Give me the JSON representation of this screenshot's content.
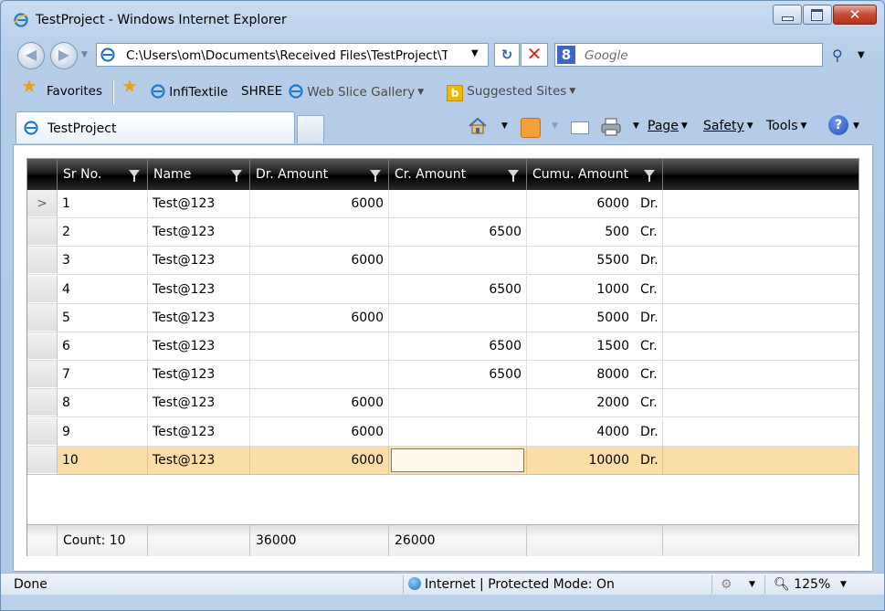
{
  "window": {
    "title": "TestProject - Windows Internet Explorer",
    "close_glyph": "✕"
  },
  "nav": {
    "back_glyph": "◀",
    "forward_glyph": "▶",
    "address": "C:\\Users\\om\\Documents\\Received Files\\TestProject\\Test",
    "search_placeholder": "Google",
    "search_logo": "8",
    "refresh_glyph": "↻",
    "stop_glyph": "✕",
    "search_go_glyph": "⚲"
  },
  "favorites": {
    "favorites_label": "Favorites",
    "links": [
      "InfiTextile",
      "SHREE",
      "Web Slice Gallery",
      "Suggested Sites"
    ]
  },
  "tab": {
    "label": "TestProject"
  },
  "commands": {
    "page": "Page",
    "safety": "Safety",
    "tools": "Tools",
    "help": "?"
  },
  "grid": {
    "columns": [
      "Sr No.",
      "Name",
      "Dr. Amount",
      "Cr. Amount",
      "Cumu. Amount"
    ],
    "current_row_glyph": ">",
    "rows": [
      {
        "sr": "1",
        "name": "Test@123",
        "dr": "6000",
        "cr": "",
        "cumu": "6000",
        "type": "Dr."
      },
      {
        "sr": "2",
        "name": "Test@123",
        "dr": "",
        "cr": "6500",
        "cumu": "500",
        "type": "Cr."
      },
      {
        "sr": "3",
        "name": "Test@123",
        "dr": "6000",
        "cr": "",
        "cumu": "5500",
        "type": "Dr."
      },
      {
        "sr": "4",
        "name": "Test@123",
        "dr": "",
        "cr": "6500",
        "cumu": "1000",
        "type": "Cr."
      },
      {
        "sr": "5",
        "name": "Test@123",
        "dr": "6000",
        "cr": "",
        "cumu": "5000",
        "type": "Dr."
      },
      {
        "sr": "6",
        "name": "Test@123",
        "dr": "",
        "cr": "6500",
        "cumu": "1500",
        "type": "Cr."
      },
      {
        "sr": "7",
        "name": "Test@123",
        "dr": "",
        "cr": "6500",
        "cumu": "8000",
        "type": "Cr."
      },
      {
        "sr": "8",
        "name": "Test@123",
        "dr": "6000",
        "cr": "",
        "cumu": "2000",
        "type": "Cr."
      },
      {
        "sr": "9",
        "name": "Test@123",
        "dr": "6000",
        "cr": "",
        "cumu": "4000",
        "type": "Dr."
      },
      {
        "sr": "10",
        "name": "Test@123",
        "dr": "6000",
        "cr": "",
        "cumu": "10000",
        "type": "Dr."
      }
    ],
    "footer": {
      "count": "Count: 10",
      "dr_total": "36000",
      "cr_total": "26000"
    }
  },
  "status": {
    "text": "Done",
    "zone": "Internet | Protected Mode: On",
    "zoom": "125%"
  },
  "colors": {
    "selected_row": "#fbdda8",
    "header_bg": "#1e1e1e",
    "frame": "#b6cde8"
  }
}
